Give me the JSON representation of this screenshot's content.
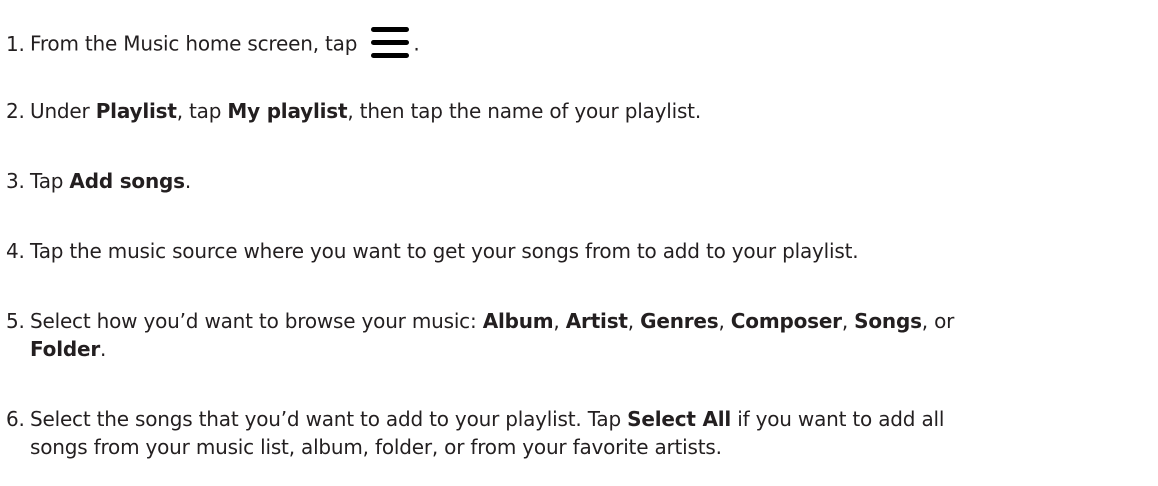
{
  "steps": [
    {
      "num": "1.",
      "text_before_icon": "From the Music home screen, tap ",
      "icon": "hamburger-menu-icon",
      "text_after_icon": "."
    },
    {
      "num": "2.",
      "t1": "Under ",
      "b1": "Playlist",
      "t2": ", tap ",
      "b2": "My playlist",
      "t3": ", then tap the name of your playlist."
    },
    {
      "num": "3.",
      "t1": "Tap ",
      "b1": "Add songs",
      "t2": "."
    },
    {
      "num": "4.",
      "t1": "Tap the music source where you want to get your songs from to add to your playlist."
    },
    {
      "num": "5.",
      "t1": "Select how you’d want to browse your music: ",
      "b1": "Album",
      "s1": ", ",
      "b2": "Artist",
      "s2": ", ",
      "b3": "Genres",
      "s3": ", ",
      "b4": "Composer",
      "s4": ", ",
      "b5": "Songs",
      "s5": ", or",
      "b6": "Folder",
      "s6": "."
    },
    {
      "num": "6.",
      "t1": "Select the songs that you’d want to add to your playlist. Tap ",
      "b1": "Select All",
      "t2": " if you want to add all",
      "t3": "songs from your music list, album, folder, or from your favorite artists."
    }
  ]
}
